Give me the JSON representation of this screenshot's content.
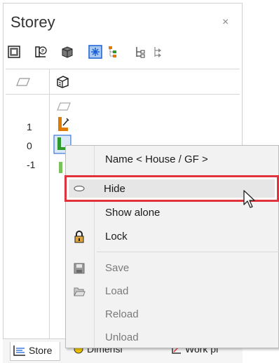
{
  "panel": {
    "title": "Storey",
    "close_glyph": "×"
  },
  "toolbar": {
    "icons": [
      "storey-properties-icon",
      "storey-parameter-icon",
      "storey-3d-icon",
      "selection-icon",
      "hierarchy-icon",
      "collapse-icon",
      "expand-icon"
    ]
  },
  "storey_list": {
    "levels": [
      "1",
      "0",
      "-1"
    ]
  },
  "context_menu": {
    "items": [
      {
        "label": "Name < House / GF >",
        "enabled": true
      },
      {
        "label": "Hide",
        "enabled": true,
        "highlighted": true
      },
      {
        "label": "Show alone",
        "enabled": true
      },
      {
        "label": "Lock",
        "enabled": true
      },
      {
        "label": "Save",
        "enabled": false
      },
      {
        "label": "Load",
        "enabled": false
      },
      {
        "label": "Reload",
        "enabled": false
      },
      {
        "label": "Unload",
        "enabled": false
      }
    ]
  },
  "bottom_tabs": [
    {
      "label": "Store",
      "active": true
    },
    {
      "label": "Dimensi",
      "active": false
    },
    {
      "label": "Work pl",
      "active": false
    }
  ],
  "colors": {
    "highlight_border": "#e0333b",
    "accent_blue": "#1a5fd6",
    "storey_orange": "#e07b00",
    "storey_green": "#2e9a2e"
  }
}
